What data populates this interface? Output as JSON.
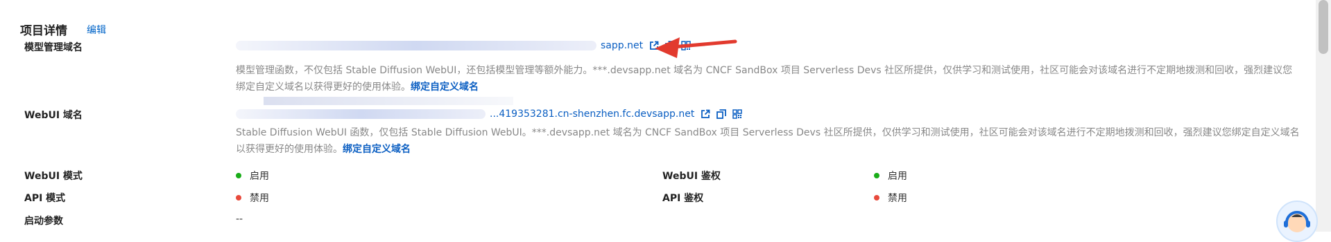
{
  "header": {
    "title": "项目详情",
    "edit_label": "编辑"
  },
  "model_domain": {
    "label": "模型管理域名",
    "domain_visible": "sapp.net",
    "description": "模型管理函数，不仅包括 Stable Diffusion WebUI，还包括模型管理等额外能力。***.devsapp.net 域名为 CNCF SandBox 项目 Serverless Devs 社区所提供，仅供学习和测试使用，社区可能会对该域名进行不定期地拨测和回收，强烈建议您绑定自定义域名以获得更好的使用体验。",
    "bind_link": "绑定自定义域名"
  },
  "webui_domain": {
    "label": "WebUI 域名",
    "domain_visible": "...419353281.cn-shenzhen.fc.devsapp.net",
    "description": "Stable Diffusion WebUI 函数，仅包括 Stable Diffusion WebUI。***.devsapp.net 域名为 CNCF SandBox 项目 Serverless Devs 社区所提供，仅供学习和测试使用，社区可能会对该域名进行不定期地拨测和回收，强烈建议您绑定自定义域名以获得更好的使用体验。",
    "bind_link": "绑定自定义域名"
  },
  "settings": {
    "webui_mode": {
      "label": "WebUI 模式",
      "value": "启用",
      "color": "#1aad19"
    },
    "webui_auth": {
      "label": "WebUI 鉴权",
      "value": "启用",
      "color": "#1aad19"
    },
    "api_mode": {
      "label": "API 模式",
      "value": "禁用",
      "color": "#e84a3c"
    },
    "api_auth": {
      "label": "API 鉴权",
      "value": "禁用",
      "color": "#e84a3c"
    },
    "startup_args": {
      "label": "启动参数",
      "value": "--"
    }
  },
  "icons": {
    "open": "external-link-icon",
    "copy": "copy-icon",
    "qr": "qr-code-icon",
    "arrow": "red-arrow-annotation",
    "assistant": "customer-service-avatar-icon"
  }
}
